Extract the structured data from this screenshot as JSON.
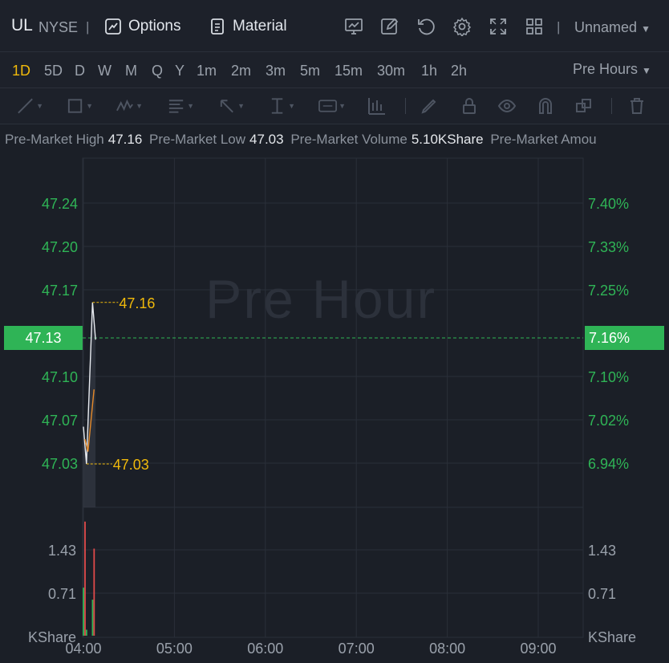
{
  "header": {
    "symbol": "UL",
    "exchange": "NYSE",
    "separator": "|",
    "options_label": "Options",
    "material_label": "Material",
    "layout_name": "Unnamed",
    "icons": [
      "chart-template-icon",
      "draw-edit-icon",
      "refresh-icon",
      "settings-icon",
      "fullscreen-icon",
      "layout-grid-icon"
    ]
  },
  "timeframes": {
    "items": [
      "1D",
      "5D",
      "D",
      "W",
      "M",
      "Q",
      "Y",
      "1m",
      "2m",
      "3m",
      "5m",
      "15m",
      "30m",
      "1h",
      "2h"
    ],
    "active": "1D",
    "session_label": "Pre Hours"
  },
  "drawing_tools": [
    "line-tool-icon",
    "rectangle-tool-icon",
    "pattern-tool-icon",
    "fib-tool-icon",
    "arrow-tool-icon",
    "measure-tool-icon",
    "number-tool-icon",
    "indicator-tool-icon",
    "brush-icon",
    "lock-icon",
    "eye-icon",
    "magnet-icon",
    "layers-icon",
    "trash-icon"
  ],
  "stats": [
    {
      "label": "Pre-Market High",
      "value": "47.16"
    },
    {
      "label": "Pre-Market Low",
      "value": "47.03"
    },
    {
      "label": "Pre-Market Volume",
      "value": "5.10KShare"
    },
    {
      "label": "Pre-Market Amou",
      "value": ""
    }
  ],
  "chart": {
    "watermark": "Pre Hour",
    "current_price": "47.13",
    "current_pct": "7.16%",
    "high_label": "47.16",
    "low_label": "47.03",
    "volume_unit": "KShare",
    "accent_color": "#2fb456",
    "up_color": "#e14a4a",
    "label_color": "#f0b90b"
  },
  "chart_data": {
    "type": "line",
    "price_axis_left": [
      "47.24",
      "47.20",
      "47.17",
      "47.10",
      "47.07",
      "47.03"
    ],
    "price_axis_right": [
      "7.40%",
      "7.33%",
      "7.25%",
      "7.10%",
      "7.02%",
      "6.94%"
    ],
    "volume_axis": [
      "1.43",
      "0.71"
    ],
    "x_ticks": [
      "04:00",
      "05:00",
      "06:00",
      "07:00",
      "08:00",
      "09:00"
    ],
    "price_series": [
      {
        "time": "04:00",
        "price": 47.06
      },
      {
        "time": "04:02",
        "price": 47.03
      },
      {
        "time": "04:06",
        "price": 47.16
      },
      {
        "time": "04:08",
        "price": 47.13
      }
    ],
    "avg_series": [
      {
        "time": "04:01",
        "price": 47.05
      },
      {
        "time": "04:03",
        "price": 47.04
      },
      {
        "time": "04:07",
        "price": 47.09
      }
    ],
    "volume_bars": [
      {
        "time": "04:00",
        "volume": 0.8,
        "color": "green"
      },
      {
        "time": "04:01",
        "volume": 1.9,
        "color": "red"
      },
      {
        "time": "04:02",
        "volume": 0.1,
        "color": "green"
      },
      {
        "time": "04:06",
        "volume": 0.6,
        "color": "green"
      },
      {
        "time": "04:07",
        "volume": 1.45,
        "color": "red"
      }
    ],
    "high": 47.16,
    "low": 47.03,
    "last": 47.13
  }
}
